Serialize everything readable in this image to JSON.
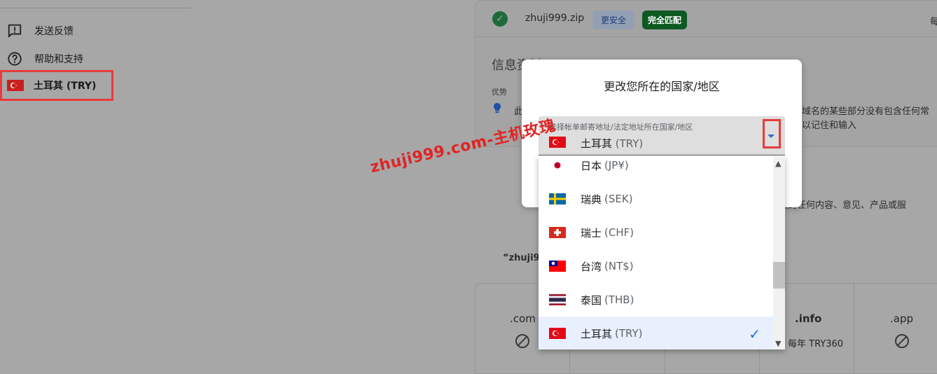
{
  "sidebar": {
    "items": [
      {
        "label": "发送反馈",
        "icon": "feedback-icon"
      },
      {
        "label": "帮助和支持",
        "icon": "help-icon"
      }
    ],
    "currency": {
      "label": "土耳其 (TRY)",
      "icon": "turkey-flag-icon"
    }
  },
  "background": {
    "domain": "zhuji999.zip",
    "badge_safe": "更安全",
    "badge_match": "完全匹配",
    "per_year": "每",
    "info_title": "信息资料",
    "adv_label": "优势",
    "adv_text": "此",
    "note_small": "i",
    "note_line1": "域名的某些部分没有包含任何常",
    "note_line2": "以记住和输入",
    "disclaimer": "联的任何内容、意见、产品或服",
    "query": "“zhuji99",
    "tlds": [
      {
        "name": ".com",
        "status": "unavailable"
      },
      {
        "name": ".info",
        "price": "每年 TRY360"
      },
      {
        "name": ".app",
        "status": "unavailable"
      }
    ]
  },
  "dialog": {
    "title": "更改您所在的国家/地区",
    "select": {
      "label": "选择帐单邮寄地址/法定地址所在国家/地区",
      "value_name": "土耳其",
      "value_code": "(TRY)"
    },
    "options": [
      {
        "name": "日本",
        "code": "(JP¥)",
        "flag": "japan"
      },
      {
        "name": "瑞典",
        "code": "(SEK)",
        "flag": "sweden"
      },
      {
        "name": "瑞士",
        "code": "(CHF)",
        "flag": "switzerland"
      },
      {
        "name": "台湾",
        "code": "(NT$)",
        "flag": "taiwan"
      },
      {
        "name": "泰国",
        "code": "(THB)",
        "flag": "thailand"
      },
      {
        "name": "土耳其",
        "code": "(TRY)",
        "flag": "turkey",
        "selected": true
      }
    ],
    "selected_check": "✓"
  },
  "scrollbar": {
    "up": "▲",
    "down": "▼"
  },
  "watermark": "zhuji999.com-主机玫瑰",
  "colors": {
    "accent": "#1a73e8",
    "highlight_box": "#ea3a3a",
    "match_badge": "#0e5a22"
  }
}
